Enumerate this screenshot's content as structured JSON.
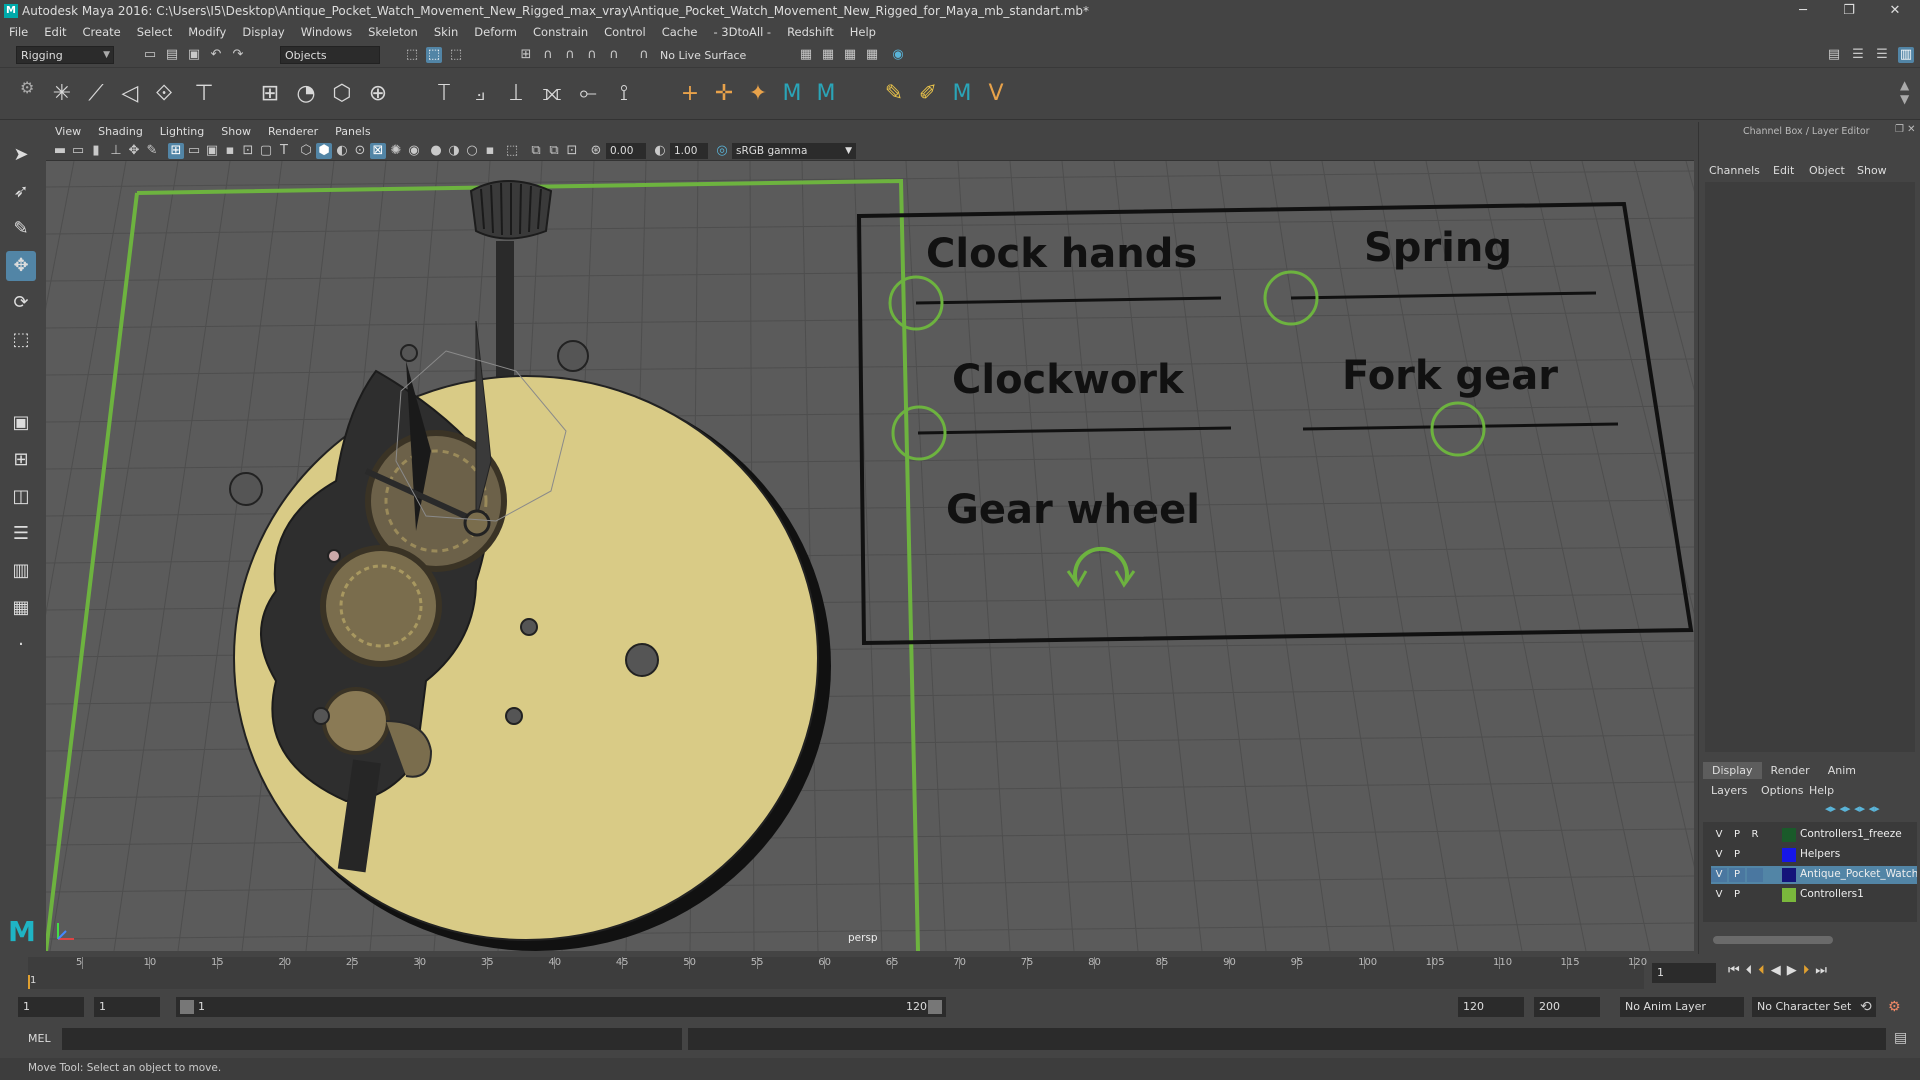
{
  "window": {
    "title": "Autodesk Maya 2016: C:\\Users\\I5\\Desktop\\Antique_Pocket_Watch_Movement_New_Rigged_max_vray\\Antique_Pocket_Watch_Movement_New_Rigged_for_Maya_mb_standart.mb*",
    "minimize": "─",
    "maximize": "❐",
    "close": "✕"
  },
  "menus": [
    "File",
    "Edit",
    "Create",
    "Select",
    "Modify",
    "Display",
    "Windows",
    "Skeleton",
    "Skin",
    "Deform",
    "Constrain",
    "Control",
    "Cache",
    "- 3DtoAll -",
    "Redshift",
    "Help"
  ],
  "status": {
    "menuset": "Rigging",
    "select_mode": "Objects",
    "live_surface": "No Live Surface"
  },
  "panel": {
    "menus": [
      "View",
      "Shading",
      "Lighting",
      "Show",
      "Renderer",
      "Panels"
    ],
    "exposure": "0.00",
    "gamma": "1.00",
    "color_space": "sRGB gamma",
    "camera_label": "persp"
  },
  "scene": {
    "labels": [
      "Clock hands",
      "Spring",
      "Clockwork",
      "Fork gear",
      "Gear wheel"
    ],
    "colors": {
      "plate": "#d9cb86",
      "wire_green": "#6db33f",
      "grid_bg": "#5c5c5c"
    }
  },
  "channelbox": {
    "header": "Channel Box / Layer Editor",
    "menus": [
      "Channels",
      "Edit",
      "Object",
      "Show"
    ],
    "layer_tabs": [
      "Display",
      "Render",
      "Anim"
    ],
    "active_tab": "Display",
    "layer_menus": [
      "Layers",
      "Options",
      "Help"
    ],
    "layers": [
      {
        "v": "V",
        "p": "P",
        "r": "R",
        "name": "Controllers1_freeze",
        "color": "#1a5a2a",
        "selected": false
      },
      {
        "v": "V",
        "p": "P",
        "r": "",
        "name": "Helpers",
        "color": "#1616e8",
        "selected": false
      },
      {
        "v": "V",
        "p": "P",
        "r": "",
        "name": "Antique_Pocket_Watch",
        "color": "#14147a",
        "selected": true
      },
      {
        "v": "V",
        "p": "P",
        "r": "",
        "name": "Controllers1",
        "color": "#7ab83c",
        "selected": false
      }
    ]
  },
  "timeline": {
    "ticks": [
      "5",
      "10",
      "15",
      "20",
      "25",
      "30",
      "35",
      "40",
      "45",
      "50",
      "55",
      "60",
      "65",
      "70",
      "75",
      "80",
      "85",
      "90",
      "95",
      "100",
      "105",
      "110",
      "115",
      "120"
    ],
    "current_frame": "1",
    "first_tick": "1",
    "range_start": "1",
    "range_start2": "1",
    "range_inner_start": "1",
    "range_inner_end": "120",
    "range_end": "120",
    "range_end2": "200",
    "anim_layer": "No Anim Layer",
    "char_set": "No Character Set"
  },
  "command": {
    "lang": "MEL"
  },
  "help": {
    "text": "Move Tool: Select an object to move."
  }
}
